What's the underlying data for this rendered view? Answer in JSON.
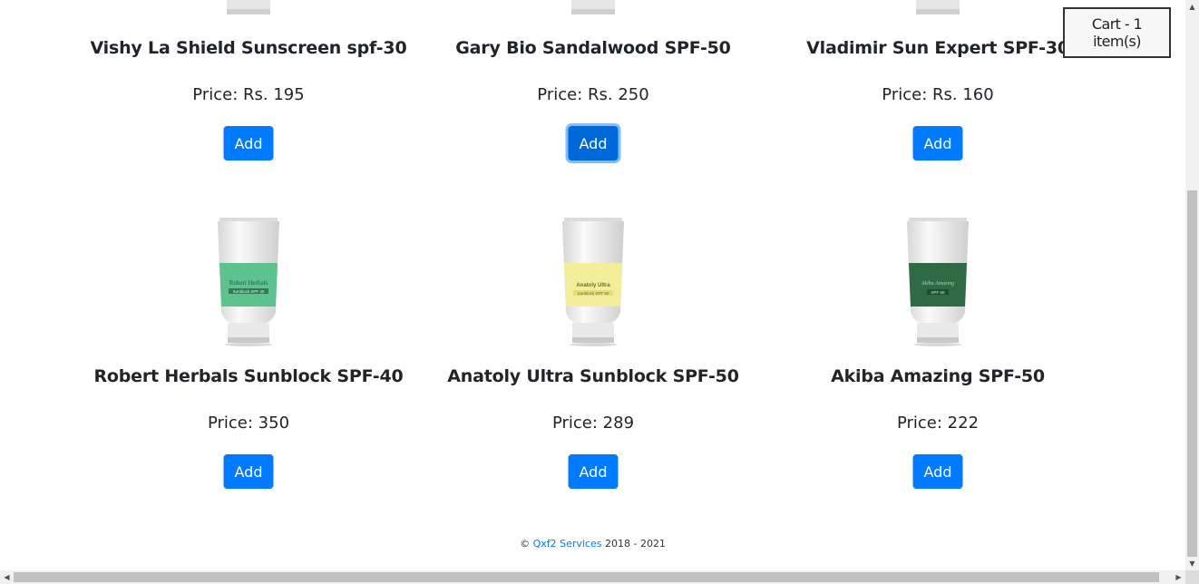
{
  "cart": {
    "label": "Cart - 1 item(s)"
  },
  "products": [
    {
      "name": "Vishy La Shield Sunscreen spf-30",
      "price": "Price: Rs. 195",
      "add_label": "Add",
      "label_color": "#e0e0e0"
    },
    {
      "name": "Gary Bio Sandalwood SPF-50",
      "price": "Price: Rs. 250",
      "add_label": "Add",
      "label_color": "#e0e0e0"
    },
    {
      "name": "Vladimir Sun Expert SPF-30",
      "price": "Price: Rs. 160",
      "add_label": "Add",
      "label_color": "#e0e0e0"
    },
    {
      "name": "Robert Herbals Sunblock SPF-40",
      "price": "Price: 350",
      "add_label": "Add",
      "label_color": "#5ec28e",
      "tube_brand": "Robert Herbals",
      "tube_sub": "Sunblock SPF 40"
    },
    {
      "name": "Anatoly Ultra Sunblock SPF-50",
      "price": "Price: 289",
      "add_label": "Add",
      "label_color": "#f3ee9a",
      "tube_brand": "Anatoly Ultra",
      "tube_sub": "Sunblock SPF 50"
    },
    {
      "name": "Akiba Amazing SPF-50",
      "price": "Price: 222",
      "add_label": "Add",
      "label_color": "#2f6a45",
      "tube_brand": "Akiba Amazing",
      "tube_sub": "SPF 50"
    }
  ],
  "footer": {
    "copyright": "©",
    "company": "Qxf2 Services",
    "years": "2018 - 2021"
  },
  "colors": {
    "accent": "#007bff"
  }
}
